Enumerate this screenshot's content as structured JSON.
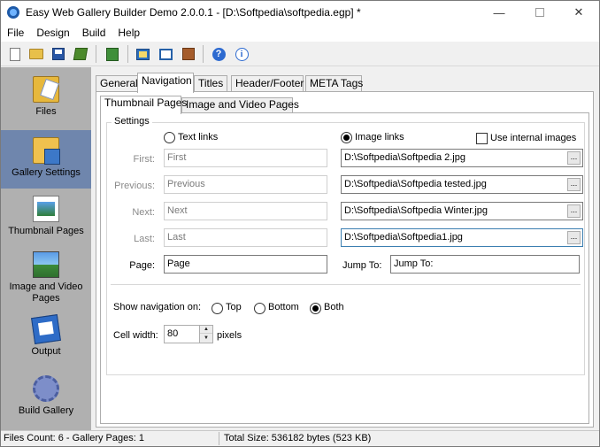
{
  "window": {
    "title": "Easy Web Gallery Builder Demo 2.0.0.1 - [D:\\Softpedia\\softpedia.egp] *",
    "minimize": "—",
    "close": "✕"
  },
  "menu": [
    "File",
    "Design",
    "Build",
    "Help"
  ],
  "toolbar": {
    "help_glyph": "?",
    "info_glyph": "i",
    "icons": [
      "new-icon",
      "open-icon",
      "save-icon",
      "export-icon",
      "build-icon",
      "gallery-icon",
      "window-icon",
      "package-icon",
      "help-icon",
      "info-icon"
    ]
  },
  "sidebar": {
    "items": [
      {
        "label": "Files",
        "icon": "files-icon",
        "active": false
      },
      {
        "label": "Gallery Settings",
        "icon": "gallery-settings-icon",
        "active": true
      },
      {
        "label": "Thumbnail Pages",
        "icon": "thumbnail-pages-icon",
        "active": false
      },
      {
        "label": "Image and Video Pages",
        "icon": "image-video-pages-icon",
        "active": false
      },
      {
        "label": "Output",
        "icon": "output-icon",
        "active": false
      },
      {
        "label": "Build Gallery",
        "icon": "build-gallery-icon",
        "active": false
      }
    ]
  },
  "tabs": {
    "outer": [
      "General",
      "Navigation",
      "Titles",
      "Header/Footer",
      "META Tags"
    ],
    "outer_active": "Navigation",
    "inner": [
      "Thumbnail Pages",
      "Image and Video Pages"
    ],
    "inner_active": "Thumbnail Pages"
  },
  "settings": {
    "legend": "Settings",
    "text_links_label": "Text links",
    "image_links_label": "Image links",
    "link_mode": "Image links",
    "use_internal_label": "Use internal images",
    "use_internal_checked": false,
    "browse_label": "...",
    "rows": [
      {
        "label": "First:",
        "text_value": "First",
        "image_value": "D:\\Softpedia\\Softpedia 2.jpg"
      },
      {
        "label": "Previous:",
        "text_value": "Previous",
        "image_value": "D:\\Softpedia\\Softpedia tested.jpg"
      },
      {
        "label": "Next:",
        "text_value": "Next",
        "image_value": "D:\\Softpedia\\Softpedia Winter.jpg"
      },
      {
        "label": "Last:",
        "text_value": "Last",
        "image_value": "D:\\Softpedia\\Softpedia1.jpg"
      }
    ],
    "page_label": "Page:",
    "page_value": "Page",
    "jump_label": "Jump To:",
    "jump_value": "Jump To:",
    "show_nav_label": "Show navigation on:",
    "nav_options": [
      "Top",
      "Bottom",
      "Both"
    ],
    "nav_selected": "Both",
    "cell_width_label": "Cell width:",
    "cell_width_value": "80",
    "cell_width_unit": "pixels",
    "spin_up": "▲",
    "spin_down": "▼"
  },
  "status": {
    "files": "Files Count: 6 - Gallery Pages: 1",
    "size": "Total Size: 536182 bytes (523 KB)"
  }
}
